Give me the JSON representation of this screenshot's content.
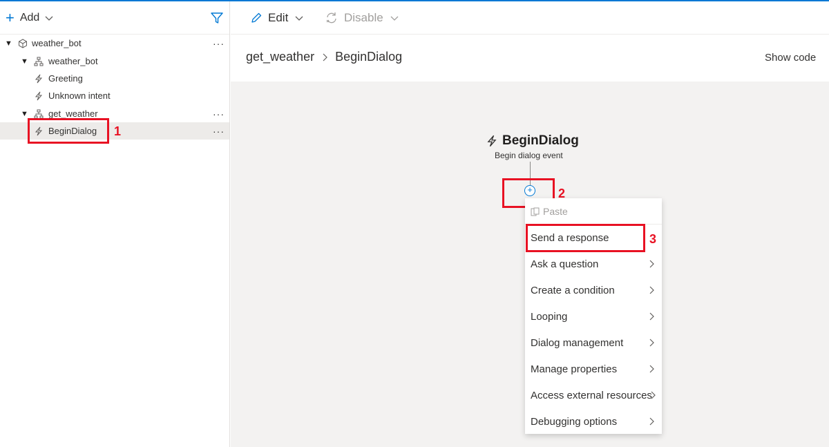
{
  "left_panel": {
    "add_label": "Add",
    "tree": [
      {
        "label": "weather_bot",
        "icon": "cube-icon"
      },
      {
        "label": "weather_bot",
        "icon": "org-chart-icon"
      },
      {
        "label": "Greeting",
        "icon": "lightning-icon"
      },
      {
        "label": "Unknown intent",
        "icon": "lightning-icon"
      },
      {
        "label": "get_weather",
        "icon": "org-chart-icon"
      },
      {
        "label": "BeginDialog",
        "icon": "lightning-icon"
      }
    ],
    "more_glyph": "···"
  },
  "toolbar": {
    "edit_label": "Edit",
    "disable_label": "Disable"
  },
  "breadcrumb": {
    "parent": "get_weather",
    "current": "BeginDialog"
  },
  "show_code_label": "Show code",
  "node": {
    "title": "BeginDialog",
    "subtitle": "Begin dialog event"
  },
  "menu": {
    "paste_label": "Paste",
    "items": [
      {
        "label": "Send a response"
      },
      {
        "label": "Ask a question"
      },
      {
        "label": "Create a condition"
      },
      {
        "label": "Looping"
      },
      {
        "label": "Dialog management"
      },
      {
        "label": "Manage properties"
      },
      {
        "label": "Access external resources"
      },
      {
        "label": "Debugging options"
      }
    ]
  },
  "annotations": [
    "1",
    "2",
    "3"
  ],
  "colors": {
    "accent": "#0078d4",
    "annotation": "#e81123",
    "canvas": "#f3f2f1",
    "selected": "#edebe9"
  }
}
